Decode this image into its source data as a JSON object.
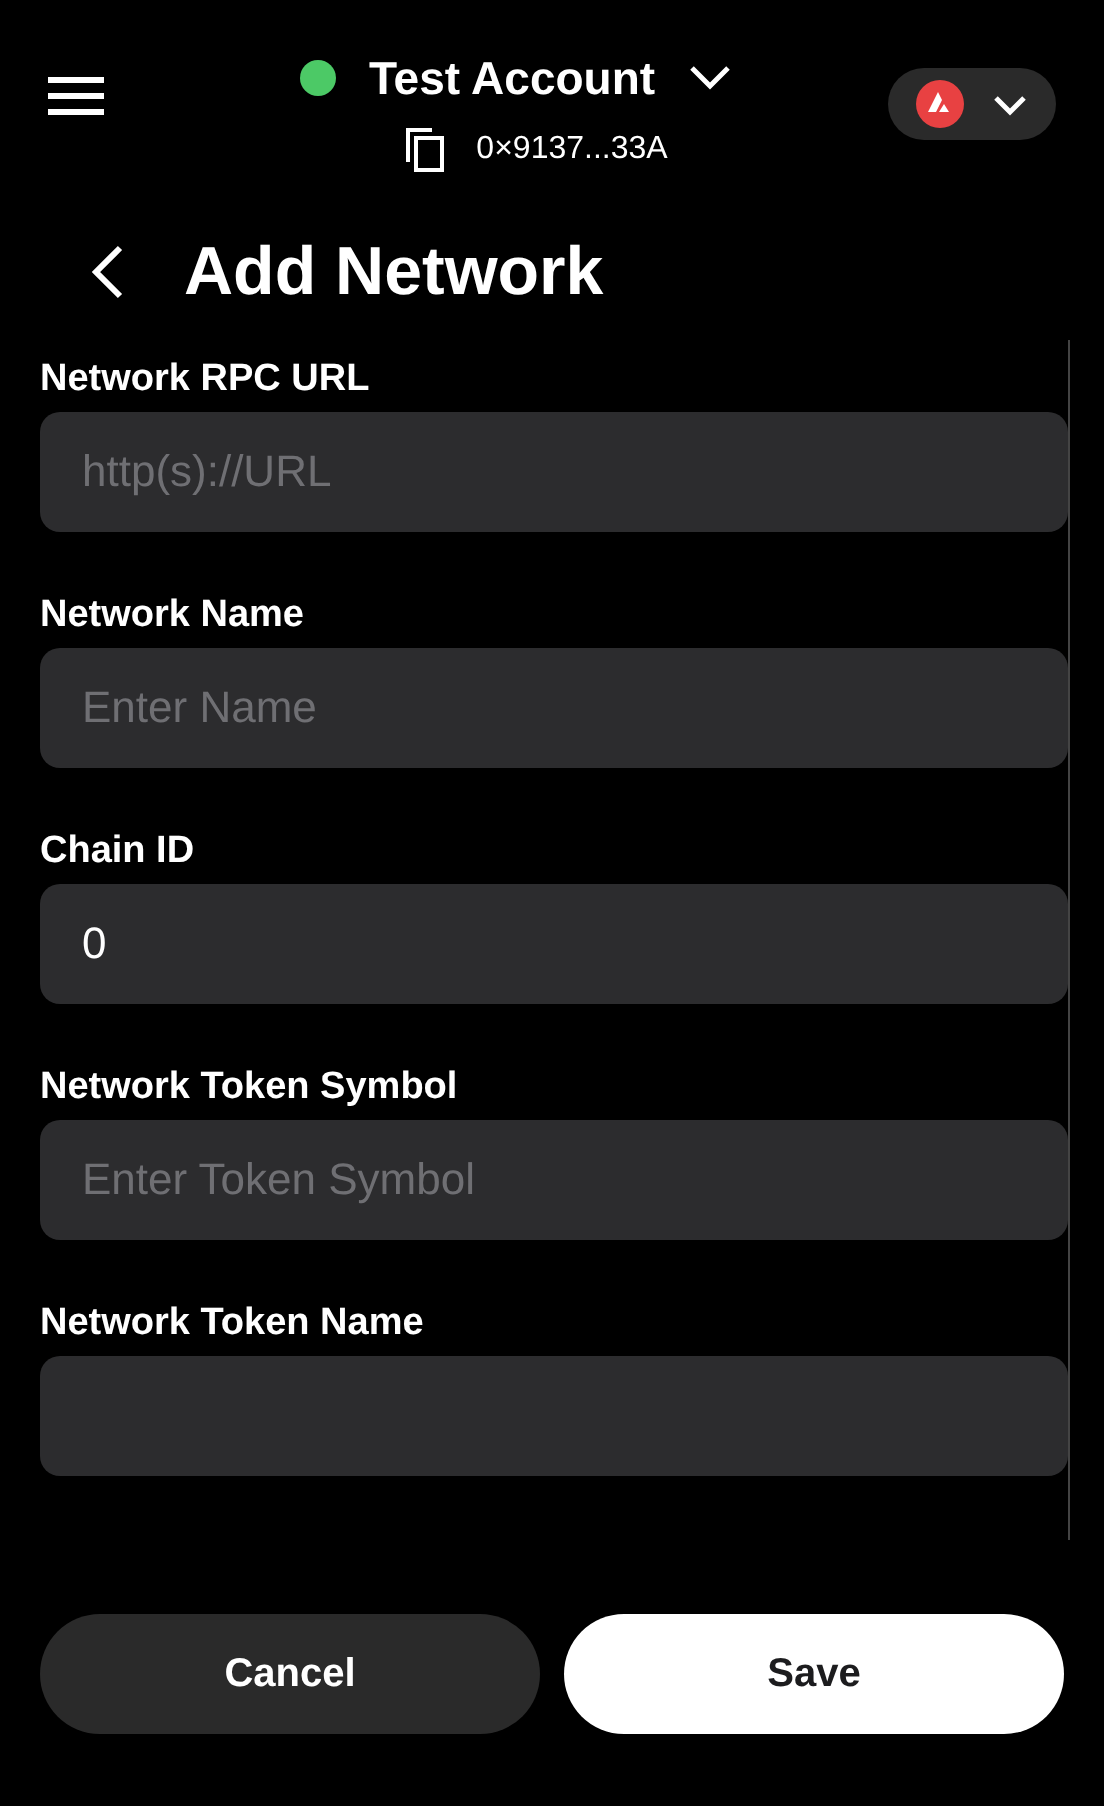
{
  "account": {
    "name": "Test Account",
    "address": "0×9137...33A"
  },
  "page_title": "Add Network",
  "fields": [
    {
      "label": "Network RPC URL",
      "placeholder": "http(s)://URL"
    },
    {
      "label": "Network Name",
      "placeholder": "Enter Name"
    },
    {
      "label": "Chain ID",
      "value": "0"
    },
    {
      "label": "Network Token Symbol",
      "placeholder": "Enter Token Symbol"
    },
    {
      "label": "Network Token Name"
    }
  ],
  "buttons": [
    {
      "label": "Cancel",
      "kind": "secondary"
    },
    {
      "label": "Save",
      "kind": "primary"
    }
  ]
}
